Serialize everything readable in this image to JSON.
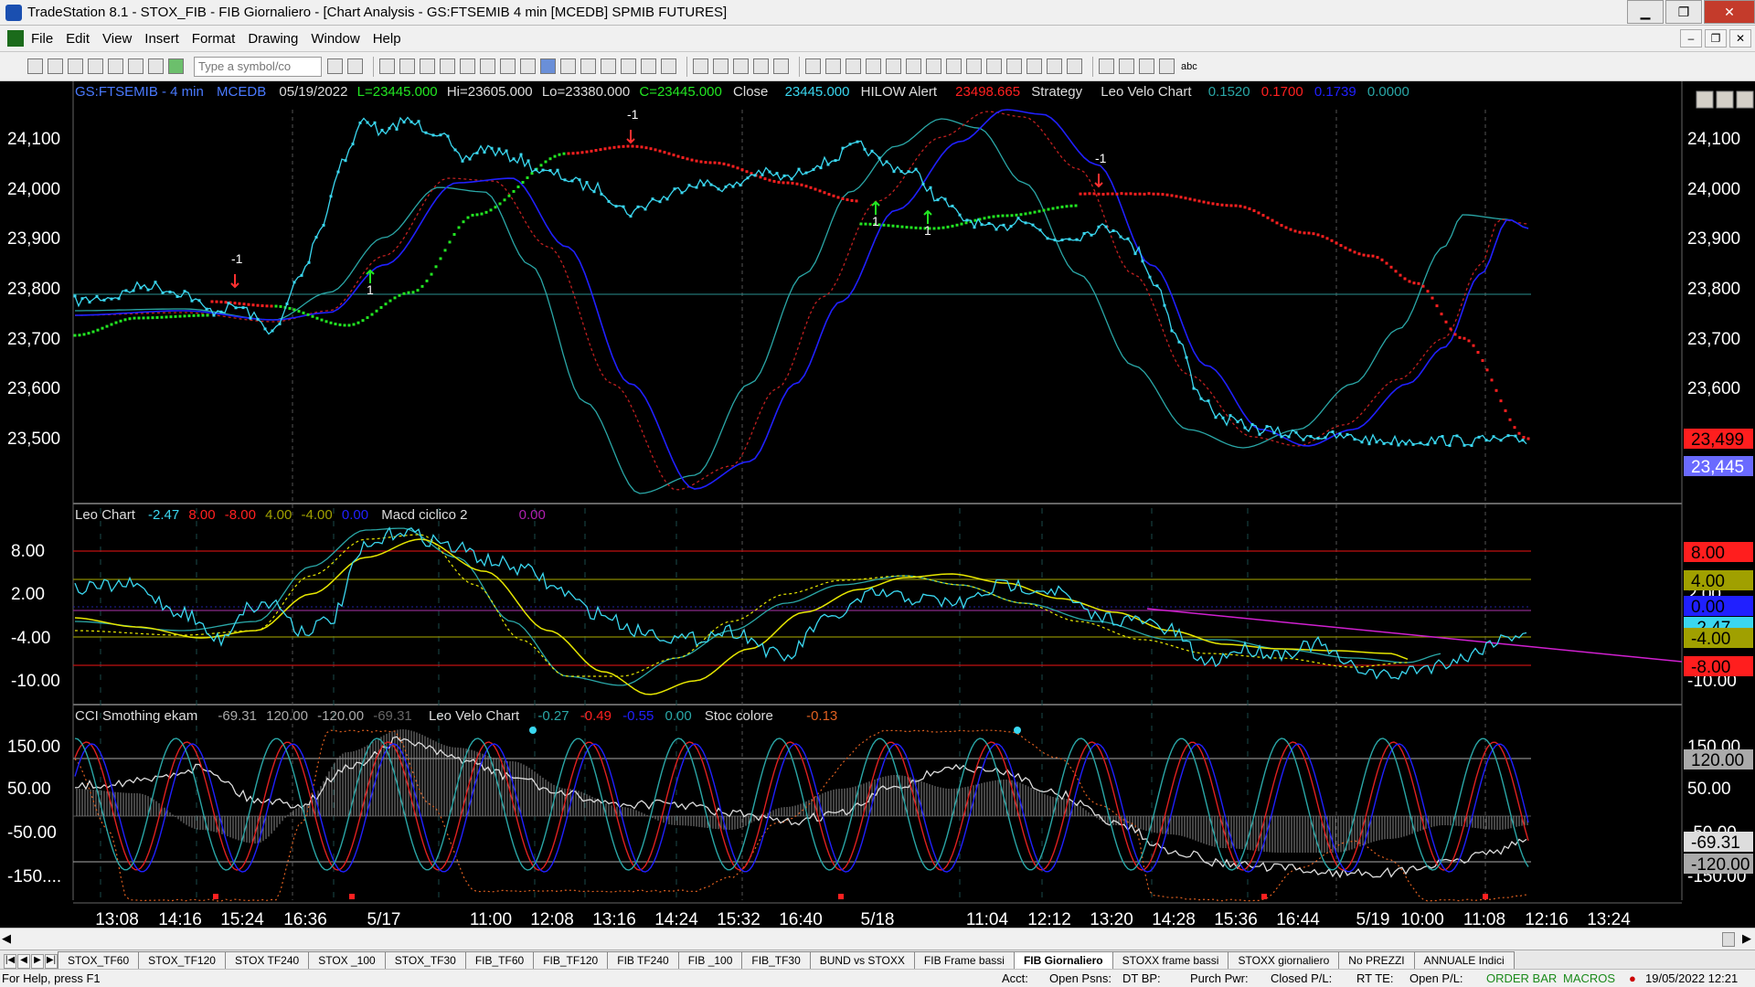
{
  "window": {
    "title": "TradeStation 8.1 - STOX_FIB - FIB Giornaliero - [Chart Analysis - GS:FTSEMIB  4 min  [MCEDB] SPMIB FUTURES]",
    "minimize": "▁",
    "maximize": "❐",
    "close": "✕"
  },
  "menu": [
    "File",
    "Edit",
    "View",
    "Insert",
    "Format",
    "Drawing",
    "Window",
    "Help"
  ],
  "toolbar": {
    "symbol_placeholder": "Type a symbol/co",
    "text_tool": "abc"
  },
  "chart": {
    "header": {
      "symbol": "GS:FTSEMIB - 4 min",
      "feed": "MCEDB",
      "date": "05/19/2022",
      "last": "L=23445.000",
      "high": "Hi=23605.000",
      "low": "Lo=23380.000",
      "close": "C=23445.000",
      "close_label": "Close",
      "close_value": "23445.000",
      "hilow_label": "HILOW Alert",
      "hilow_value": "23498.665",
      "strategy_label": "Strategy",
      "velo_label": "Leo Velo Chart",
      "velo_v1": "0.1520",
      "velo_v2": "0.1700",
      "velo_v3": "0.1739",
      "velo_v4": "0.0000"
    },
    "panel2_header": {
      "label": "Leo Chart",
      "v1": "-2.47",
      "v2": "8.00",
      "v3": "-8.00",
      "v4": "4.00",
      "v5": "-4.00",
      "v6": "0.00",
      "macd_label": "Macd ciclico 2",
      "macd_value": "0.00"
    },
    "panel3_header": {
      "label": "CCI Smothing ekam",
      "v1": "-69.31",
      "v2": "120.00",
      "v3": "-120.00",
      "v4": "-69.31",
      "velo_label": "Leo Velo Chart",
      "velo_v1": "-0.27",
      "velo_v2": "-0.49",
      "velo_v3": "-0.55",
      "velo_v4": "0.00",
      "stoc_label": "Stoc colore",
      "stoc_value": "-0.13"
    },
    "price_axis": [
      "24,100",
      "24,000",
      "23,900",
      "23,800",
      "23,700",
      "23,600",
      "23,500"
    ],
    "price_axis_right": [
      "24,100",
      "24,000",
      "23,900",
      "23,800",
      "23,700",
      "23,600",
      "23,500"
    ],
    "price_badges": {
      "hilow": "23,499",
      "last": "23,445"
    },
    "panel2_axis": [
      "8.00",
      "2.00",
      "-4.00",
      "-10.00"
    ],
    "panel2_axis_right": [
      "2.00",
      "-4.00",
      "-10.00"
    ],
    "panel2_badges": [
      "8.00",
      "4.00",
      "0.00",
      "-2.47",
      "-4.00",
      "-8.00"
    ],
    "panel3_axis": [
      "150.00",
      "50.00",
      "-50.00",
      "-150...."
    ],
    "panel3_axis_right": [
      "150.00",
      "50.00",
      "-50.00",
      "-150.00"
    ],
    "panel3_badges": [
      "120.00",
      "-69.31",
      "-120.00"
    ],
    "signals": [
      "-1",
      "1",
      "-1",
      "1",
      "1",
      "-1"
    ],
    "time_axis": [
      "13:08",
      "14:16",
      "15:24",
      "16:36",
      "5/17",
      "11:00",
      "12:08",
      "13:16",
      "14:24",
      "15:32",
      "16:40",
      "5/18",
      "11:04",
      "12:12",
      "13:20",
      "14:28",
      "15:36",
      "16:44",
      "5/19",
      "10:00",
      "11:08",
      "12:16",
      "13:24"
    ],
    "colors": {
      "price": "#3ad7f0",
      "hilow_up": "#22e622",
      "hilow_down": "#ff2020",
      "blue": "#2020ff",
      "teal": "#2aa7a7",
      "red_dash": "#c02020",
      "yellow": "#e6e600",
      "magenta": "#d020d0"
    }
  },
  "tabs": [
    "STOX_TF60",
    "STOX_TF120",
    "STOX TF240",
    "STOX _100",
    "STOX_TF30",
    "FIB_TF60",
    "FIB_TF120",
    "FIB TF240",
    "FIB _100",
    "FIB_TF30",
    "BUND vs STOXX",
    "FIB Frame bassi",
    "FIB Giornaliero",
    "STOXX frame bassi",
    "STOXX giornaliero",
    "No PREZZI",
    "ANNUALE Indici"
  ],
  "active_tab": "FIB Giornaliero",
  "status": {
    "help": "For Help, press F1",
    "acct": "Acct:",
    "open_psns": "Open Psns:",
    "dt_bp": "DT BP:",
    "purch_pwr": "Purch Pwr:",
    "closed_pl": "Closed P/L:",
    "rt_te": "RT TE:",
    "open_pl": "Open P/L:",
    "order_bar": "ORDER BAR",
    "macros": "MACROS",
    "datetime": "19/05/2022 12:21"
  }
}
